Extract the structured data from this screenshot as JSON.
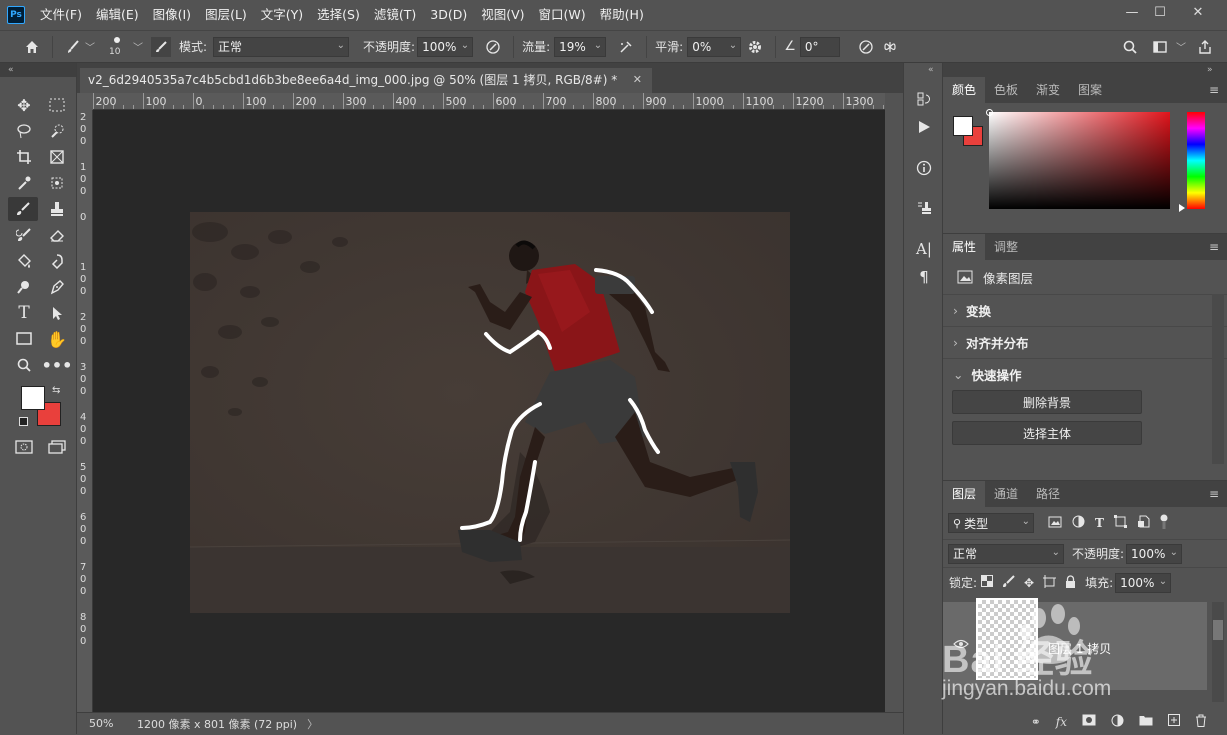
{
  "menubar": {
    "logo": "Ps",
    "items": [
      "文件(F)",
      "编辑(E)",
      "图像(I)",
      "图层(L)",
      "文字(Y)",
      "选择(S)",
      "滤镜(T)",
      "3D(D)",
      "视图(V)",
      "窗口(W)",
      "帮助(H)"
    ]
  },
  "options": {
    "brush_size": "10",
    "mode_label": "模式:",
    "mode_value": "正常",
    "opacity_label": "不透明度:",
    "opacity_value": "100%",
    "flow_label": "流量:",
    "flow_value": "19%",
    "smooth_label": "平滑:",
    "smooth_value": "0%",
    "angle_value": "0°"
  },
  "document": {
    "tab_title": "v2_6d2940535a7c4b5cbd1d6b3be8ee6a4d_img_000.jpg @ 50% (图层 1 拷贝, RGB/8#) *",
    "zoom": "50%",
    "size_info": "1200 像素 x 801 像素 (72 ppi)"
  },
  "ruler": {
    "h_labels": [
      "200",
      "100",
      "0",
      "100",
      "200",
      "300",
      "400",
      "500",
      "600",
      "700",
      "800",
      "900",
      "1000",
      "1100",
      "1200",
      "1300"
    ],
    "v_labels": [
      "2 0 0",
      "1 0 0",
      "0",
      "1 0 0",
      "2 0 0",
      "3 0 0",
      "4 0 0",
      "5 0 0",
      "6 0 0",
      "7 0 0",
      "8 0 0"
    ]
  },
  "color_panel": {
    "tabs": [
      "颜色",
      "色板",
      "渐变",
      "图案"
    ],
    "foreground": "#ffffff",
    "background": "#e9403c"
  },
  "properties_panel": {
    "tabs": [
      "属性",
      "调整"
    ],
    "layer_type": "像素图层",
    "sections": [
      "变换",
      "对齐并分布",
      "快速操作"
    ],
    "buttons": [
      "删除背景",
      "选择主体"
    ]
  },
  "layers_panel": {
    "tabs": [
      "图层",
      "通道",
      "路径"
    ],
    "filter_label": "类型",
    "blend_mode": "正常",
    "opacity_label": "不透明度:",
    "opacity_value": "100%",
    "lock_label": "锁定:",
    "fill_label": "填充:",
    "fill_value": "100%",
    "layer_name": "图层 1 拷贝"
  },
  "watermark": {
    "text_big": "Bai 经验",
    "text_small": "jingyan.baidu.com"
  }
}
